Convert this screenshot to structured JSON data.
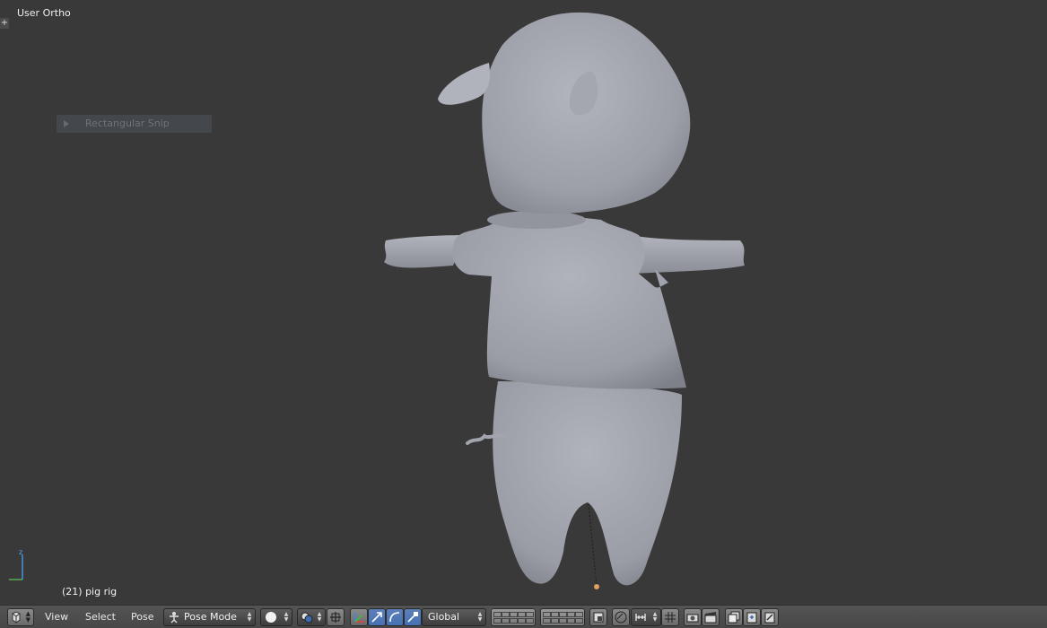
{
  "viewport": {
    "view_name": "User Ortho",
    "corner_plus": "+",
    "operator_panel": "Rectangular Snip",
    "status": "(21) pig rig",
    "axis_label": "z"
  },
  "header": {
    "menus": [
      "View",
      "Select",
      "Pose"
    ],
    "mode": "Pose Mode",
    "orientation": "Global"
  },
  "colors": {
    "background": "#393939",
    "model": "#a9abb5",
    "header": "#4d4d4d",
    "active_button": "#5680c2"
  }
}
